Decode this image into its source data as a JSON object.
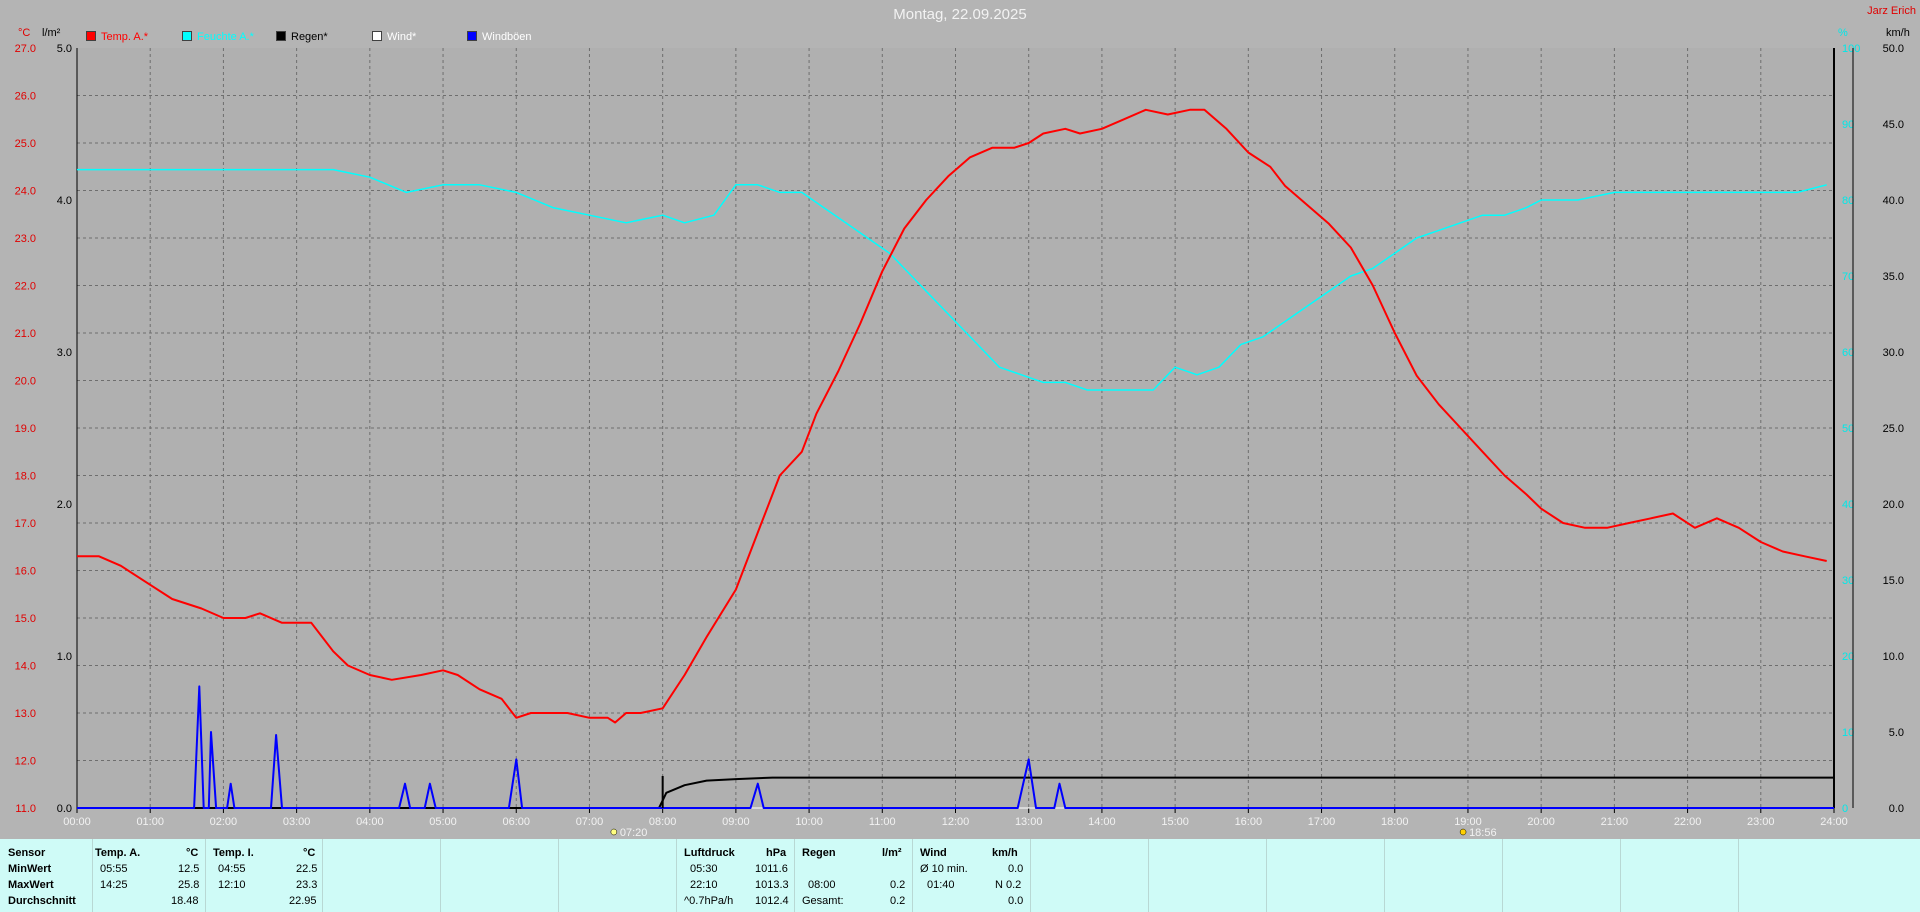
{
  "title": "Montag, 22.09.2025",
  "brand": "Jarz Erich",
  "axis_units": {
    "temp": "°C",
    "rain": "l/m²",
    "humidity": "%",
    "wind": "km/h"
  },
  "legend": [
    {
      "label": "Temp. A.*",
      "color": "#ff0000",
      "text_color": "#ff0000"
    },
    {
      "label": "Feuchte A.*",
      "color": "#00ffff",
      "text_color": "#00ffff"
    },
    {
      "label": "Regen*",
      "color": "#000000",
      "text_color": "#000000"
    },
    {
      "label": "Wind*",
      "color": "#ffffff",
      "text_color": "#ffffff"
    },
    {
      "label": "Windböen",
      "color": "#0000ff",
      "text_color": "#ffffff"
    }
  ],
  "markers": {
    "sunrise": "07:20",
    "sunset": "18:56"
  },
  "chart_data": {
    "type": "line",
    "title": "Montag, 22.09.2025",
    "x_unit": "hours",
    "xlim": [
      0,
      24
    ],
    "x_ticks": [
      "00:00",
      "01:00",
      "02:00",
      "03:00",
      "04:00",
      "05:00",
      "06:00",
      "07:00",
      "08:00",
      "09:00",
      "10:00",
      "11:00",
      "12:00",
      "13:00",
      "14:00",
      "15:00",
      "16:00",
      "17:00",
      "18:00",
      "19:00",
      "20:00",
      "21:00",
      "22:00",
      "23:00",
      "24:00"
    ],
    "axes": {
      "temp": {
        "unit": "°C",
        "min": 11,
        "max": 27,
        "ticks": [
          "11.0",
          "12.0",
          "13.0",
          "14.0",
          "15.0",
          "16.0",
          "17.0",
          "18.0",
          "19.0",
          "20.0",
          "21.0",
          "22.0",
          "23.0",
          "24.0",
          "25.0",
          "26.0",
          "27.0"
        ]
      },
      "rain": {
        "unit": "l/m²",
        "min": 0,
        "max": 5,
        "ticks": [
          "0.0",
          "1.0",
          "2.0",
          "3.0",
          "4.0",
          "5.0"
        ]
      },
      "humidity": {
        "unit": "%",
        "min": 0,
        "max": 100,
        "ticks": [
          "0",
          "10",
          "20",
          "30",
          "40",
          "50",
          "60",
          "70",
          "80",
          "90",
          "100"
        ]
      },
      "wind": {
        "unit": "km/h",
        "min": 0,
        "max": 50,
        "ticks": [
          "0.0",
          "5.0",
          "10.0",
          "15.0",
          "20.0",
          "25.0",
          "30.0",
          "35.0",
          "40.0",
          "45.0",
          "50.0"
        ]
      }
    },
    "grid": true,
    "legend_position": "top-left",
    "series": [
      {
        "name": "Temp. A.*",
        "axis": "temp",
        "color": "#ff0000",
        "x": [
          0,
          0.3,
          0.6,
          1,
          1.3,
          1.7,
          2,
          2.3,
          2.5,
          2.8,
          3,
          3.2,
          3.5,
          3.7,
          4,
          4.3,
          4.7,
          5,
          5.2,
          5.5,
          5.8,
          6,
          6.2,
          6.5,
          6.7,
          7,
          7.25,
          7.35,
          7.5,
          7.7,
          8,
          8.3,
          8.6,
          9,
          9.3,
          9.6,
          9.9,
          10.1,
          10.4,
          10.7,
          11,
          11.3,
          11.6,
          11.9,
          12.2,
          12.5,
          12.8,
          13,
          13.2,
          13.5,
          13.7,
          14,
          14.3,
          14.6,
          14.9,
          15.2,
          15.4,
          15.7,
          16,
          16.3,
          16.5,
          16.8,
          17.1,
          17.4,
          17.7,
          18,
          18.3,
          18.6,
          18.9,
          19.2,
          19.5,
          19.8,
          20,
          20.3,
          20.6,
          20.9,
          21.2,
          21.5,
          21.8,
          22.1,
          22.4,
          22.7,
          23,
          23.3,
          23.6,
          23.9
        ],
        "values": [
          16.3,
          16.3,
          16.1,
          15.7,
          15.4,
          15.2,
          15.0,
          15.0,
          15.1,
          14.9,
          14.9,
          14.9,
          14.3,
          14.0,
          13.8,
          13.7,
          13.8,
          13.9,
          13.8,
          13.5,
          13.3,
          12.9,
          13.0,
          13.0,
          13.0,
          12.9,
          12.9,
          12.8,
          13.0,
          13.0,
          13.1,
          13.8,
          14.6,
          15.6,
          16.8,
          18.0,
          18.5,
          19.3,
          20.2,
          21.2,
          22.3,
          23.2,
          23.8,
          24.3,
          24.7,
          24.9,
          24.9,
          25.0,
          25.2,
          25.3,
          25.2,
          25.3,
          25.5,
          25.7,
          25.6,
          25.7,
          25.7,
          25.3,
          24.8,
          24.5,
          24.1,
          23.7,
          23.3,
          22.8,
          22.0,
          21.0,
          20.1,
          19.5,
          19.0,
          18.5,
          18.0,
          17.6,
          17.3,
          17.0,
          16.9,
          16.9,
          17.0,
          17.1,
          17.2,
          16.9,
          17.1,
          16.9,
          16.6,
          16.4,
          16.3,
          16.2
        ]
      },
      {
        "name": "Feuchte A.*",
        "axis": "humidity",
        "color": "#00ffff",
        "x": [
          0,
          0.5,
          1,
          1.5,
          2,
          2.5,
          3,
          3.5,
          4,
          4.5,
          5,
          5.5,
          6,
          6.5,
          7,
          7.5,
          8,
          8.3,
          8.7,
          9,
          9.3,
          9.6,
          9.9,
          10.2,
          10.5,
          10.8,
          11.1,
          11.4,
          11.7,
          12,
          12.3,
          12.6,
          12.9,
          13.2,
          13.5,
          13.8,
          14.1,
          14.4,
          14.7,
          15,
          15.3,
          15.6,
          15.9,
          16.2,
          16.5,
          16.8,
          17.1,
          17.4,
          17.7,
          18,
          18.3,
          18.6,
          18.9,
          19.2,
          19.5,
          19.8,
          20,
          20.5,
          21,
          21.5,
          22,
          22.5,
          23,
          23.5,
          23.9
        ],
        "values": [
          84,
          84,
          84,
          84,
          84,
          84,
          84,
          84,
          83,
          81,
          82,
          82,
          81,
          79,
          78,
          77,
          78,
          77,
          78,
          82,
          82,
          81,
          81,
          79,
          77,
          75,
          73,
          70,
          67,
          64,
          61,
          58,
          57,
          56,
          56,
          55,
          55,
          55,
          55,
          58,
          57,
          58,
          61,
          62,
          64,
          66,
          68,
          70,
          71,
          73,
          75,
          76,
          77,
          78,
          78,
          79,
          80,
          80,
          81,
          81,
          81,
          81,
          81,
          81,
          82
        ]
      },
      {
        "name": "Regen*",
        "axis": "rain",
        "color": "#000000",
        "x": [
          0,
          7.95,
          8.0,
          8.05,
          8.3,
          8.6,
          9,
          9.5,
          10,
          24
        ],
        "values": [
          0,
          0,
          0.05,
          0.1,
          0.15,
          0.18,
          0.19,
          0.2,
          0.2,
          0.2
        ]
      },
      {
        "name": "Wind*",
        "axis": "wind",
        "color": "#ffffff",
        "x": [
          0,
          24
        ],
        "values": [
          0,
          0
        ]
      },
      {
        "name": "Windböen",
        "axis": "wind",
        "color": "#0000ff",
        "x": [
          0,
          1.6,
          1.67,
          1.73,
          1.8,
          1.83,
          1.9,
          2.05,
          2.1,
          2.15,
          2.65,
          2.72,
          2.8,
          4.4,
          4.48,
          4.55,
          4.75,
          4.82,
          4.9,
          5.9,
          6.0,
          6.08,
          9.2,
          9.3,
          9.38,
          12.85,
          13.0,
          13.1,
          13.35,
          13.42,
          13.5,
          24
        ],
        "values": [
          0,
          0,
          8,
          0,
          0,
          5,
          0,
          0,
          1.6,
          0,
          0,
          4.8,
          0,
          0,
          1.6,
          0,
          0,
          1.6,
          0,
          0,
          3.2,
          0,
          0,
          1.6,
          0,
          0,
          3.2,
          0,
          0,
          1.6,
          0,
          0
        ]
      }
    ]
  },
  "table": {
    "rows_labels": {
      "sensor": "Sensor",
      "min": "MinWert",
      "max": "MaxWert",
      "avg": "Durchschnitt"
    },
    "temp_a": {
      "header": "Temp. A.",
      "unit": "°C",
      "min_time": "05:55",
      "min_val": "12.5",
      "max_time": "14:25",
      "max_val": "25.8",
      "avg": "18.48"
    },
    "temp_i": {
      "header": "Temp. I.",
      "unit": "°C",
      "min_time": "04:55",
      "min_val": "22.5",
      "max_time": "12:10",
      "max_val": "23.3",
      "avg": "22.95"
    },
    "pressure": {
      "header": "Luftdruck",
      "unit": "hPa",
      "min_time": "05:30",
      "min_val": "1011.6",
      "max_time": "22:10",
      "max_val": "1013.3",
      "trend": "^0.7hPa/h",
      "avg": "1012.4"
    },
    "rain": {
      "header": "Regen",
      "unit": "l/m²",
      "time": "08:00",
      "val": "0.2",
      "total_label": "Gesamt:",
      "total": "0.2"
    },
    "wind": {
      "header": "Wind",
      "unit": "km/h",
      "avg_label": "Ø 10 min.",
      "avg": "0.0",
      "max_time": "01:40",
      "max_val": "N 0.2",
      "day_avg": "0.0"
    }
  }
}
